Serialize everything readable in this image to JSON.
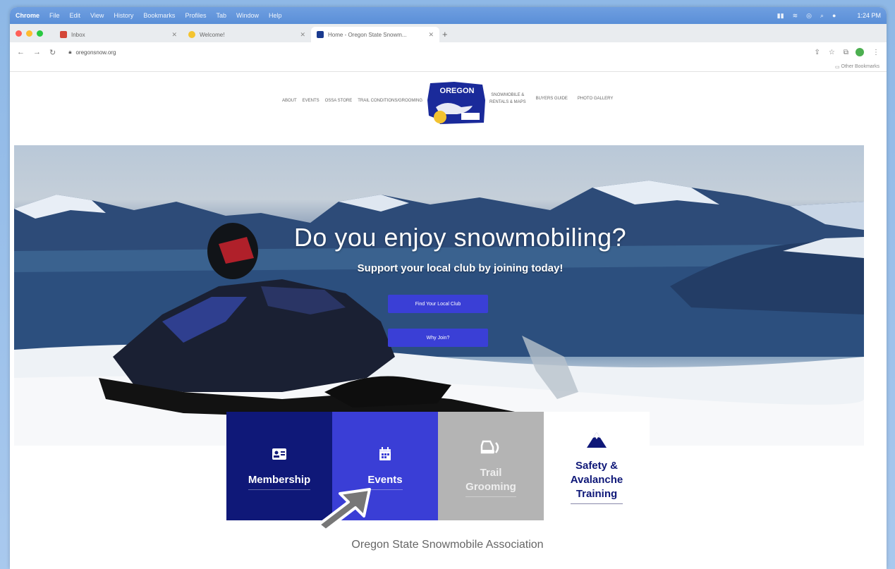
{
  "menubar": {
    "app": "Chrome",
    "items": [
      "File",
      "Edit",
      "View",
      "History",
      "Bookmarks",
      "Profiles",
      "Tab",
      "Window",
      "Help"
    ],
    "clock": "1:24 PM"
  },
  "tabs": [
    {
      "title": "Inbox",
      "favicon_color": "#d44638"
    },
    {
      "title": "Welcome!",
      "favicon_color": "#f4c430"
    },
    {
      "title": "Home - Oregon State Snowm...",
      "favicon_color": "#1a3a8f"
    }
  ],
  "address": {
    "url": "oregonsnow.org"
  },
  "bookmarks": {
    "right": "Other Bookmarks"
  },
  "site": {
    "nav_left": [
      "ABOUT",
      "EVENTS",
      "OSSA STORE",
      "TRAIL CONDITIONS/GROOMING"
    ],
    "nav_right_line1": "SNOWMOBILE &",
    "nav_right_line2": "RENTALS & MAPS",
    "nav_right": [
      "BUYERS GUIDE",
      "PHOTO GALLERY"
    ],
    "logo_text": "OREGON"
  },
  "hero": {
    "title": "Do you enjoy snowmobiling?",
    "subtitle": "Support your local club by joining today!",
    "btn_find": "Find Your Local Club",
    "btn_why": "Why Join?"
  },
  "tiles": {
    "membership": "Membership",
    "events": "Events",
    "grooming_1": "Trail",
    "grooming_2": "Grooming",
    "safety_1": "Safety &",
    "safety_2": "Avalanche",
    "safety_3": "Training"
  },
  "footer": {
    "title": "Oregon State Snowmobile Association"
  },
  "colors": {
    "navy": "#0f1878",
    "blue": "#3a3ed6",
    "gray": "#b4b4b4"
  }
}
